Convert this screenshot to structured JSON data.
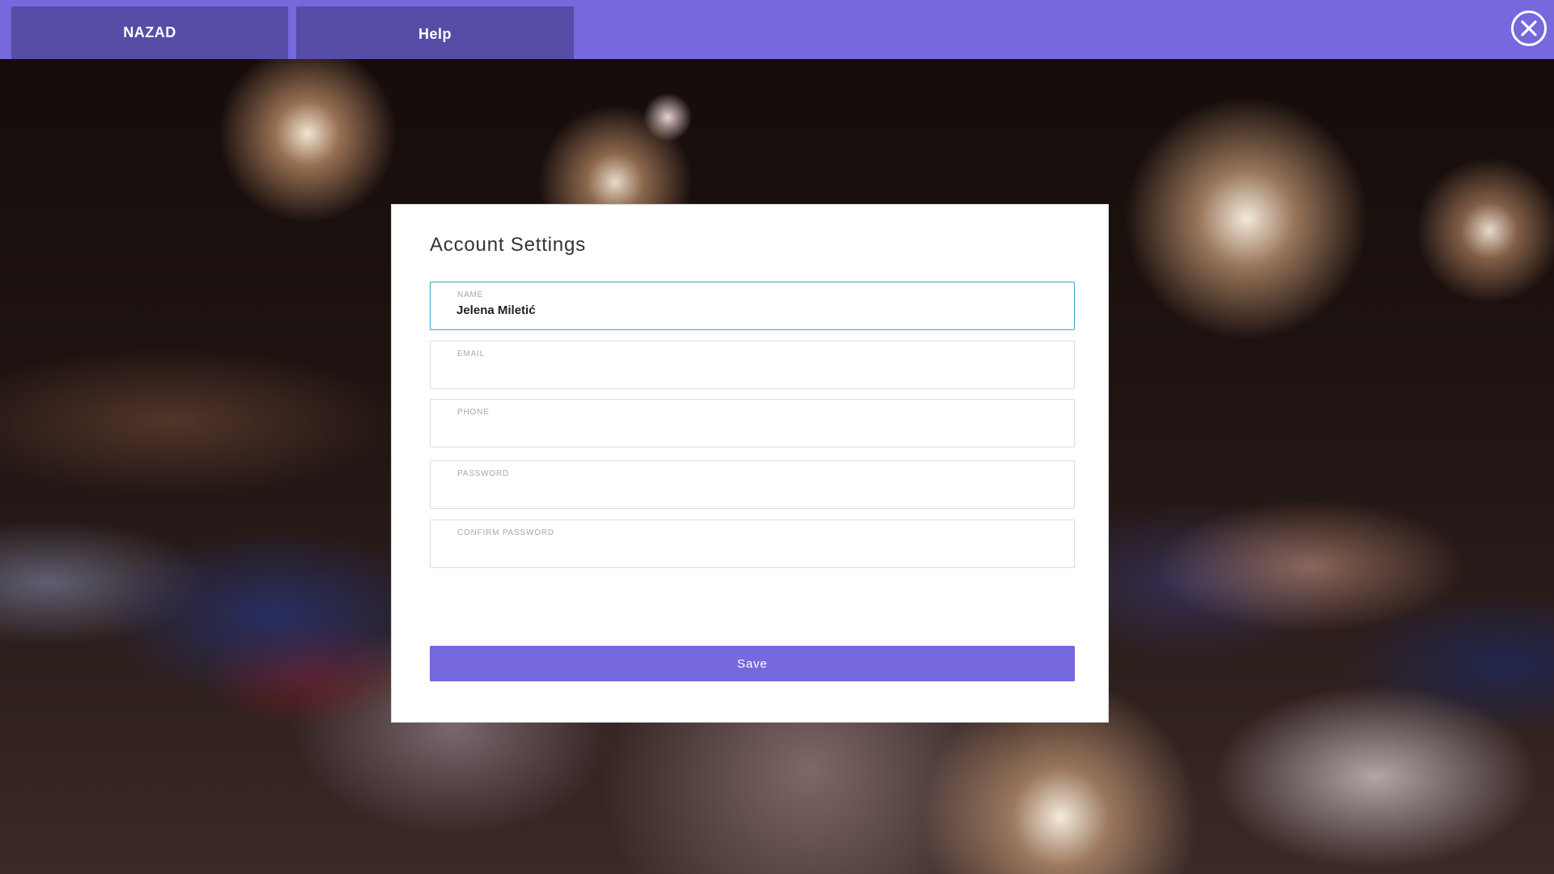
{
  "colors": {
    "accent": "#7569dd",
    "tab_bg": "#574ca6",
    "focus_border": "#3aa7d1",
    "modal_bg": "#ffffff"
  },
  "topbar": {
    "back_label": "NAZAD",
    "help_label": "Help",
    "close_icon": "close-circle-icon"
  },
  "modal": {
    "title": "Account Settings",
    "fields": [
      {
        "label": "NAME",
        "value": "Jelena Miletić",
        "active": true
      },
      {
        "label": "EMAIL",
        "value": ""
      },
      {
        "label": "PHONE",
        "value": ""
      },
      {
        "label": "PASSWORD",
        "value": ""
      },
      {
        "label": "CONFIRM PASSWORD",
        "value": ""
      }
    ],
    "save_label": "Save"
  }
}
